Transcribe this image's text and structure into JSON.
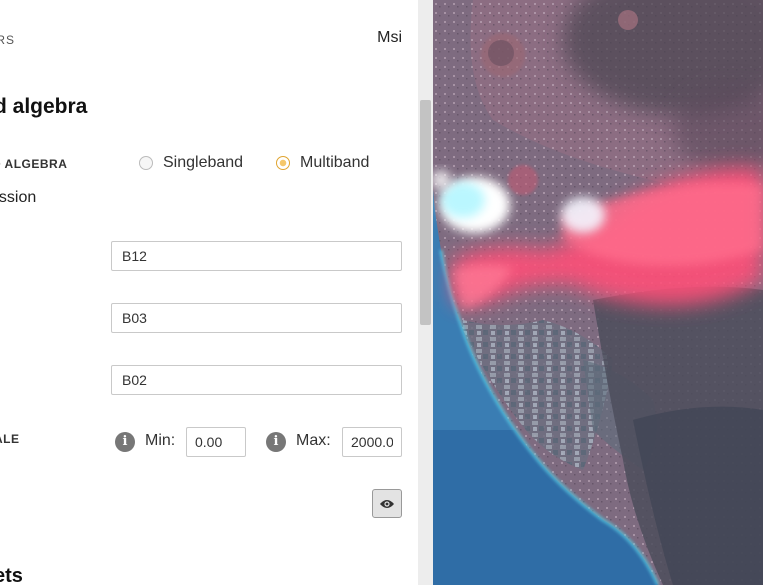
{
  "breadcrumb": {
    "text": "ORS"
  },
  "sensor": {
    "name": "Msi"
  },
  "section": {
    "title": "d algebra",
    "bottom_title": "ets"
  },
  "band_algebra": {
    "label": "D ALGEBRA",
    "modes": [
      {
        "label": "Singleband",
        "selected": false
      },
      {
        "label": "Multiband",
        "selected": true
      }
    ]
  },
  "expression": {
    "label": "ession"
  },
  "bands": {
    "red": "B12",
    "green": "B03",
    "blue": "B02"
  },
  "scale": {
    "label": "ALE",
    "min_label": "Min:",
    "min_value": "0.00",
    "max_label": "Max:",
    "max_value": "2000.0"
  },
  "preview": {
    "icon": "eye-icon"
  },
  "colors": {
    "accent": "#f5c76a",
    "lava": "#ff4f78",
    "sea": "#3a7db3"
  }
}
